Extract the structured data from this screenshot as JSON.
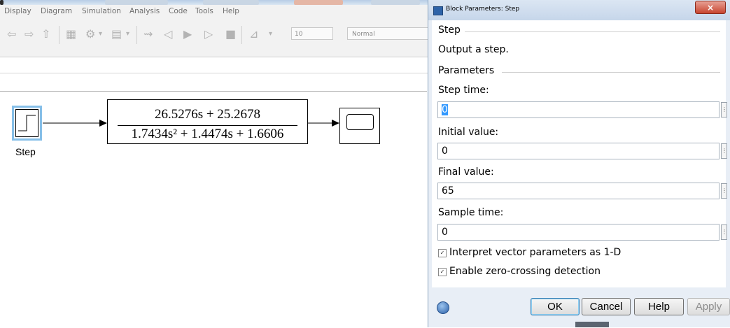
{
  "simulink": {
    "menu": [
      "Display",
      "Diagram",
      "Simulation",
      "Analysis",
      "Code",
      "Tools",
      "Help"
    ],
    "stop_time": "10",
    "sim_mode": "Normal",
    "blocks": {
      "step_label": "Step",
      "tf_numerator": "26.5276s + 25.2678",
      "tf_denominator": "1.7434s² + 1.4474s + 1.6606"
    }
  },
  "dialog": {
    "title": "Block Parameters: Step",
    "close_glyph": "×",
    "block_group": "Step",
    "description": "Output a step.",
    "params_group": "Parameters",
    "fields": [
      {
        "label": "Step time:",
        "value": "0"
      },
      {
        "label": "Initial value:",
        "value": "0"
      },
      {
        "label": "Final value:",
        "value": "65"
      },
      {
        "label": "Sample time:",
        "value": "0"
      }
    ],
    "checkboxes": [
      {
        "label": "Interpret vector parameters as 1-D",
        "checked": true
      },
      {
        "label": "Enable zero-crossing detection",
        "checked": true
      }
    ],
    "buttons": {
      "ok": "OK",
      "cancel": "Cancel",
      "help": "Help",
      "apply": "Apply"
    }
  },
  "colors": {
    "selection": "#3399ff",
    "block_highlight": "#86bfe8",
    "dialog_frame": "#e8eef6"
  }
}
